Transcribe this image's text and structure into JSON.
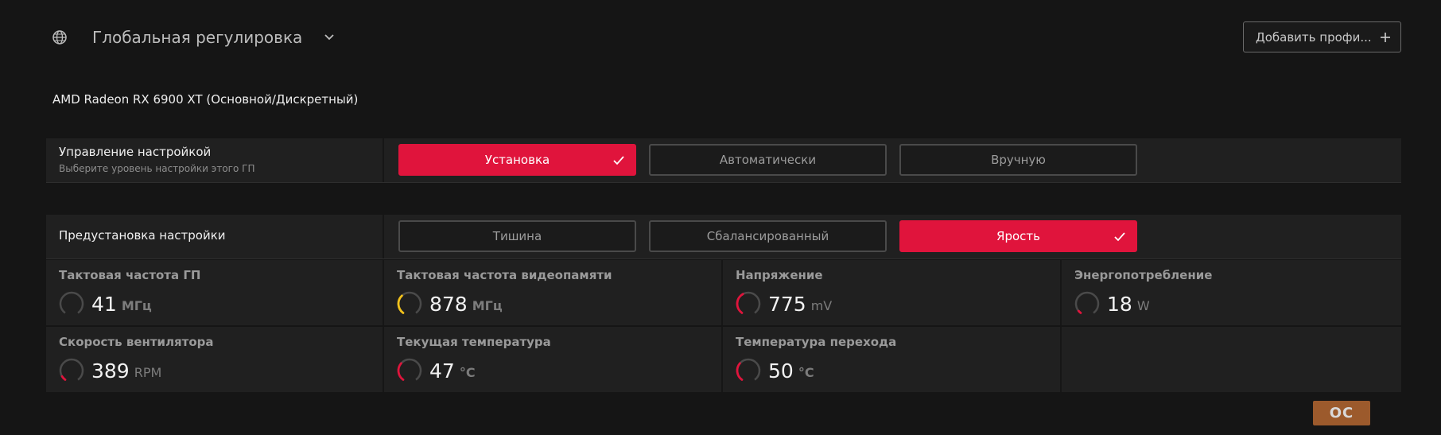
{
  "header": {
    "profile_name": "Глобальная регулировка",
    "add_profile_label": "Добавить профи..."
  },
  "gpu": {
    "name": "AMD Radeon RX 6900 XT (Основной/Дискретный)"
  },
  "tuning_control": {
    "title": "Управление настройкой",
    "subtitle": "Выберите уровень настройки этого ГП",
    "options": [
      {
        "label": "Установка",
        "active": true
      },
      {
        "label": "Автоматически",
        "active": false
      },
      {
        "label": "Вручную",
        "active": false
      }
    ]
  },
  "tuning_preset": {
    "title": "Предустановка настройки",
    "options": [
      {
        "label": "Тишина",
        "active": false
      },
      {
        "label": "Сбалансированный",
        "active": false
      },
      {
        "label": "Ярость",
        "active": true
      }
    ]
  },
  "metrics": [
    {
      "label": "Тактовая частота ГП",
      "value": "41",
      "unit": "МГц",
      "gauge_color": "#555555",
      "gauge_fraction": 0.0
    },
    {
      "label": "Тактовая частота видеопамяти",
      "value": "878",
      "unit": "МГц",
      "gauge_color": "#f2c21b",
      "gauge_fraction": 0.35
    },
    {
      "label": "Напряжение",
      "value": "775",
      "unit": "mV",
      "gauge_color": "#e0143c",
      "gauge_fraction": 0.4
    },
    {
      "label": "Энергопотребление",
      "value": "18",
      "unit": "W",
      "gauge_color": "#e0143c",
      "gauge_fraction": 0.05
    },
    {
      "label": "Скорость вентилятора",
      "value": "389",
      "unit": "RPM",
      "gauge_color": "#e0143c",
      "gauge_fraction": 0.08
    },
    {
      "label": "Текущая температура",
      "value": "47",
      "unit": "°C",
      "gauge_color": "#e0143c",
      "gauge_fraction": 0.33
    },
    {
      "label": "Температура перехода",
      "value": "50",
      "unit": "°C",
      "gauge_color": "#e0143c",
      "gauge_fraction": 0.33
    }
  ],
  "badge": {
    "label": "OC"
  },
  "colors": {
    "accent": "#e0143c",
    "background": "#151515",
    "panel": "#202020"
  },
  "icons": {
    "profile": "globe-icon",
    "dropdown": "chevron-down-icon",
    "add": "plus-icon",
    "selected": "check-icon",
    "metric": "gauge-icon"
  }
}
